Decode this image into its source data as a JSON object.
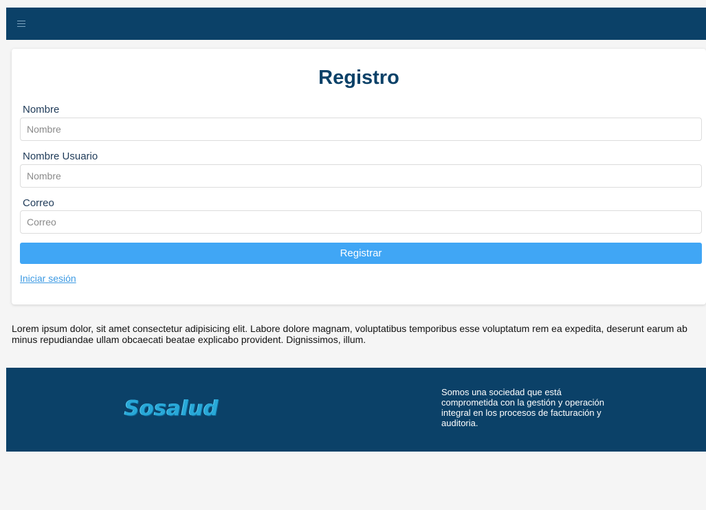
{
  "header": {
    "menu_icon": "hamburger-icon"
  },
  "form": {
    "title": "Registro",
    "fields": [
      {
        "label": "Nombre",
        "placeholder": "Nombre",
        "value": ""
      },
      {
        "label": "Nombre Usuario",
        "placeholder": "Nombre",
        "value": ""
      },
      {
        "label": "Correo",
        "placeholder": "Correo",
        "value": ""
      }
    ],
    "submit_label": "Registrar",
    "login_link": "Iniciar sesión"
  },
  "intro_text": "Lorem ipsum dolor, sit amet consectetur adipisicing elit. Labore dolore magnam, voluptatibus temporibus esse voluptatum rem ea expedita, deserunt earum ab minus repudiandae ullam obcaecati beatae explicabo provident. Dignissimos, illum.",
  "footer": {
    "logo_text": "Sosalud",
    "description": "Somos una sociedad que está comprometida con la gestión y operación integral en los procesos de facturación y auditoria."
  },
  "colors": {
    "brand_dark": "#0b4168",
    "button": "#40a6f5",
    "link": "#3d9ae3",
    "background": "#f5f5f5"
  }
}
